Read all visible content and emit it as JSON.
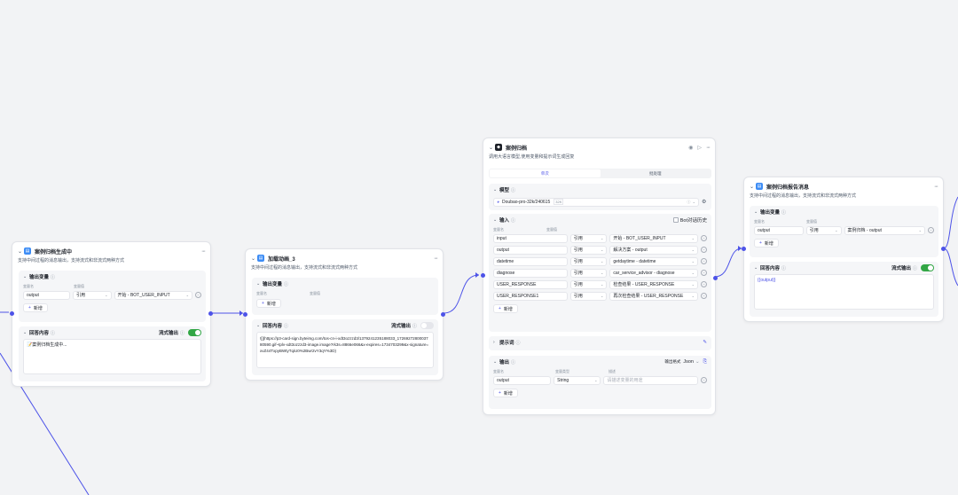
{
  "node1": {
    "title": "案例归档生成中",
    "desc": "支持中间过程的消息输出，支持流式和非流式两种方式",
    "output_vars": "输出变量",
    "col_name": "变量名",
    "col_value": "变量值",
    "rows": [
      {
        "name": "output",
        "type": "引用",
        "value": "开始 - BOT_USER_INPUT"
      }
    ],
    "add": "新增",
    "reply": "回答内容",
    "stream": "流式输出",
    "reply_text": "📝案例归档生成中..."
  },
  "node2": {
    "title": "加载动画_3",
    "desc": "支持中间过程的消息输出，支持流式和非流式两种方式",
    "output_vars": "输出变量",
    "col_name": "变量名",
    "col_value": "变量值",
    "add": "新增",
    "reply": "回答内容",
    "stream": "流式输出",
    "reply_text": "![](https://p3-card-sign.byteimg.com/tos-cn-i-xdt3ozzzd3/1379241235188033_1726927280003780590.gif~tplv-xdt3ozzzd3-image.image?rk3s=8866e066&x-expires=1734703299&x-signature=xvZ44TxpyBWtyTqiU0%2Bwr2vY3qY%3D)"
  },
  "node3": {
    "title": "案例归档",
    "desc": "调用大语言模型,使用变量和提示词生成回复",
    "tab_single": "单次",
    "tab_batch": "批处理",
    "model_label": "模型",
    "model_value": "Doubao-pro-32k/240615",
    "model_tag": "32K",
    "input_label": "输入",
    "chat_history": "Bot对话历史",
    "col_name": "变量名",
    "col_value": "变量值",
    "rows": [
      {
        "name": "input",
        "type": "引用",
        "value": "开始 - BOT_USER_INPUT"
      },
      {
        "name": "output",
        "type": "引用",
        "value": "解决方案 - output"
      },
      {
        "name": "datetime",
        "type": "引用",
        "value": "getdaytime - datetime"
      },
      {
        "name": "diagnose",
        "type": "引用",
        "value": "car_service_advisor - diagnose"
      },
      {
        "name": "USER_RESPONSE",
        "type": "引用",
        "value": "检查结果 - USER_RESPONSE"
      },
      {
        "name": "USER_RESPONSE1",
        "type": "引用",
        "value": "再次检查结果 - USER_RESPONSE"
      }
    ],
    "add": "新增",
    "prompt_label": "提示词",
    "output_label": "输出",
    "output_format_label": "输出格式",
    "output_format": "Json",
    "out_col_name": "变量名",
    "out_col_type": "变量类型",
    "out_col_desc": "描述",
    "out_rows": [
      {
        "name": "output",
        "type": "String",
        "desc_placeholder": "请描述变量的用途"
      }
    ],
    "out_add": "新增"
  },
  "node4": {
    "title": "案例归档报告消息",
    "desc": "支持中间过程的消息输出，支持流式和非流式两种方式",
    "output_vars": "输出变量",
    "col_name": "变量名",
    "col_value": "变量值",
    "rows": [
      {
        "name": "output",
        "type": "引用",
        "value": "案例归档 - output"
      }
    ],
    "add": "新增",
    "reply": "回答内容",
    "stream": "流式输出",
    "reply_text": "{{output}}"
  },
  "colors": {
    "accent": "#4d53e8",
    "toggle_on": "#32a645",
    "node_icon": "#3c8cf5"
  }
}
